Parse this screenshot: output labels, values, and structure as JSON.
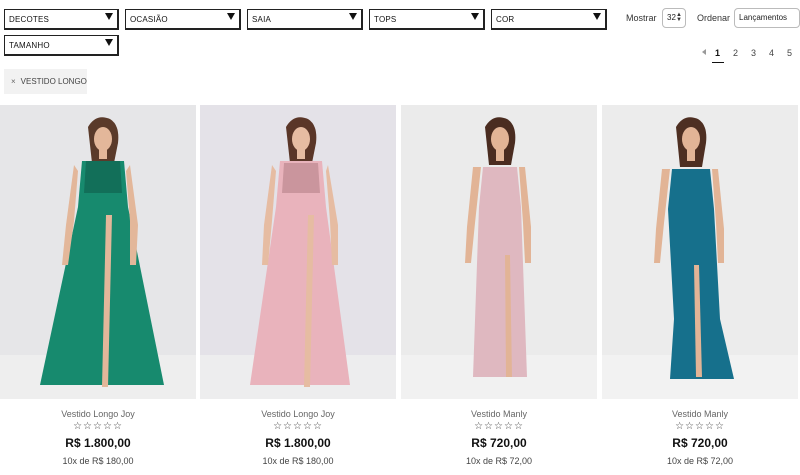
{
  "filters": {
    "decotes": "DECOTES",
    "ocasiao": "OCASIÃO",
    "saia": "SAIA",
    "tops": "TOPS",
    "cor": "COR",
    "tamanho": "TAMANHO"
  },
  "controls": {
    "show_label": "Mostrar",
    "show_value": "32",
    "order_label": "Ordenar",
    "order_value": "Lançamentos"
  },
  "pagination": {
    "pages": [
      "1",
      "2",
      "3",
      "4",
      "5"
    ],
    "current": "1"
  },
  "active_filter": {
    "remove_symbol": "×",
    "label": "VESTIDO LONGO"
  },
  "products": [
    {
      "name": "Vestido Longo Joy",
      "rating": "☆☆☆☆☆",
      "price": "R$ 1.800,00",
      "installments": "10x de R$ 180,00",
      "color": "#178a6e"
    },
    {
      "name": "Vestido Longo Joy",
      "rating": "☆☆☆☆☆",
      "price": "R$ 1.800,00",
      "installments": "10x de R$ 180,00",
      "color": "#e9b3bc"
    },
    {
      "name": "Vestido Manly",
      "rating": "☆☆☆☆☆",
      "price": "R$ 720,00",
      "installments": "10x de R$ 72,00",
      "color": "#dfb8c0"
    },
    {
      "name": "Vestido Manly",
      "rating": "☆☆☆☆☆",
      "price": "R$ 720,00",
      "installments": "10x de R$ 72,00",
      "color": "#16708c"
    }
  ]
}
